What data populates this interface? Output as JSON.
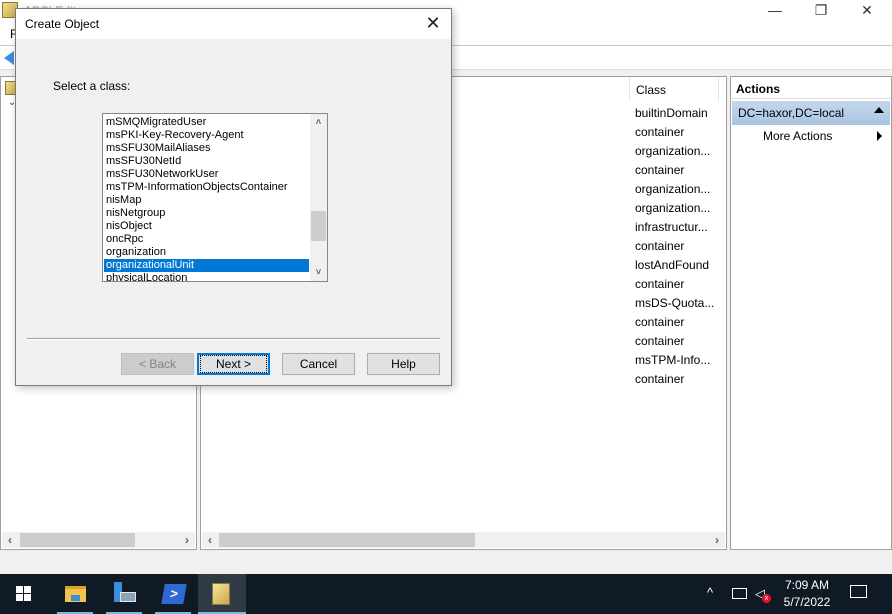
{
  "window": {
    "title": "ADSI Edit",
    "menu_first": "F",
    "controls": {
      "minimize": "—",
      "maximize": "❐",
      "close": "✕"
    }
  },
  "list_pane": {
    "column_header": "Class",
    "classes": [
      "builtinDomain",
      "container",
      "organization...",
      "container",
      "organization...",
      "organization...",
      "infrastructur...",
      "container",
      "lostAndFound",
      "container",
      "msDS-Quota...",
      "container",
      "container",
      "msTPM-Info...",
      "container"
    ]
  },
  "actions_pane": {
    "header": "Actions",
    "section": "DC=haxor,DC=local",
    "items": [
      "More Actions"
    ]
  },
  "dialog": {
    "title": "Create Object",
    "prompt": "Select a class:",
    "classes": [
      "mSMQMigratedUser",
      "msPKI-Key-Recovery-Agent",
      "msSFU30MailAliases",
      "msSFU30NetId",
      "msSFU30NetworkUser",
      "msTPM-InformationObjectsContainer",
      "nisMap",
      "nisNetgroup",
      "nisObject",
      "oncRpc",
      "organization",
      "organizationalUnit",
      "physicalLocation"
    ],
    "selected_class": "organizationalUnit",
    "buttons": {
      "back": "< Back",
      "next": "Next >",
      "cancel": "Cancel",
      "help": "Help"
    },
    "close_glyph": "✕"
  },
  "scrollbars": {
    "left": "‹",
    "right": "›",
    "up": "˄",
    "down": "˅"
  },
  "taskbar": {
    "apps": [
      "file-explorer",
      "server-manager",
      "powershell",
      "adsi-edit"
    ],
    "active_app": "adsi-edit",
    "tray": {
      "caret": "^"
    },
    "time": "7:09 AM",
    "date": "5/7/2022"
  },
  "colors": {
    "selection": "#0078d7",
    "taskbar": "#101a24",
    "accent_underline": "#76b9ed"
  }
}
